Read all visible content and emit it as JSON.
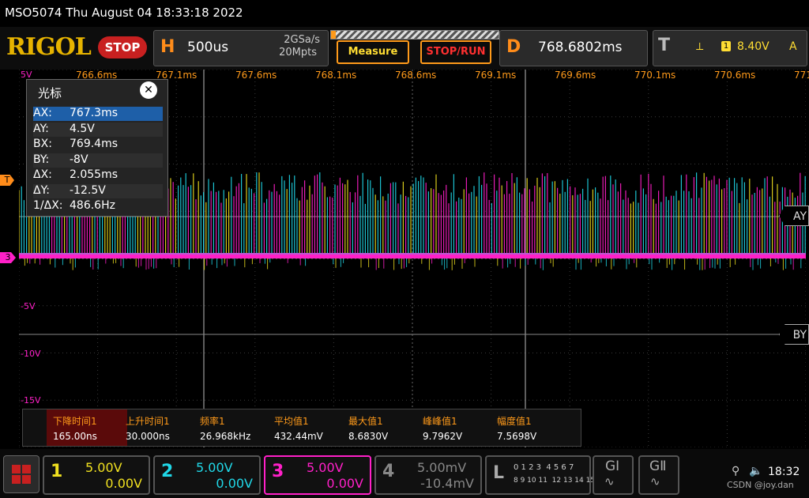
{
  "title_bar": {
    "text": "MSO5074  Thu August 04 18:33:18 2022"
  },
  "toolbar": {
    "logo": "RIGOL",
    "stop_label": "STOP",
    "h_letter": "H",
    "timebase": "500us",
    "sample_rate": "2GSa/s",
    "memory_depth": "20Mpts",
    "measure_label": "Measure",
    "stoprun_label": "STOP/RUN",
    "d_letter": "D",
    "delay": "768.6802ms",
    "t_letter": "T",
    "trigger_channel": "1",
    "trigger_level": "8.40V",
    "trigger_mode": "A"
  },
  "time_axis": {
    "labels": [
      "766.6ms",
      "767.1ms",
      "767.6ms",
      "768.1ms",
      "768.6ms",
      "769.1ms",
      "769.6ms",
      "770.1ms",
      "770.6ms",
      "771.1ms"
    ]
  },
  "volt_axis": {
    "labels": [
      "5V",
      "-5V",
      "-10V",
      "-15V"
    ]
  },
  "markers": {
    "trigger": "T",
    "ch3": "3",
    "ay": "AY",
    "by": "BY"
  },
  "cursor": {
    "title": "光标",
    "rows": [
      {
        "k": "AX:",
        "v": "767.3ms"
      },
      {
        "k": "AY:",
        "v": "4.5V"
      },
      {
        "k": "BX:",
        "v": "769.4ms"
      },
      {
        "k": "BY:",
        "v": "-8V"
      },
      {
        "k": "ΔX:",
        "v": "2.055ms"
      },
      {
        "k": "ΔY:",
        "v": "-12.5V"
      },
      {
        "k": "1/ΔX:",
        "v": "486.6Hz"
      }
    ]
  },
  "measurements": [
    {
      "label": "下降时间1",
      "value": "165.00ns"
    },
    {
      "label": "上升时间1",
      "value": "30.000ns"
    },
    {
      "label": "频率1",
      "value": "26.968kHz"
    },
    {
      "label": "平均值1",
      "value": "432.44mV"
    },
    {
      "label": "最大值1",
      "value": "8.6830V"
    },
    {
      "label": "峰峰值1",
      "value": "9.7962V"
    },
    {
      "label": "幅度值1",
      "value": "7.5698V"
    }
  ],
  "channels": [
    {
      "num": "1",
      "scale": "5.00V",
      "offset": "0.00V",
      "color": "#f0e020"
    },
    {
      "num": "2",
      "scale": "5.00V",
      "offset": "0.00V",
      "color": "#20d8e8"
    },
    {
      "num": "3",
      "scale": "5.00V",
      "offset": "0.00V",
      "color": "#ff20c8"
    },
    {
      "num": "4",
      "scale": "5.00mV",
      "offset": "-10.4mV",
      "color": "#888888"
    }
  ],
  "logic": {
    "letter": "L",
    "row1": "0 1 2 3  4 5 6 7",
    "row2": "8 9 10 11  12 13 14 15"
  },
  "gen1": "GⅠ",
  "gen2": "GⅡ",
  "status": {
    "clock": "18:32",
    "watermark": "CSDN @joy.dan"
  }
}
